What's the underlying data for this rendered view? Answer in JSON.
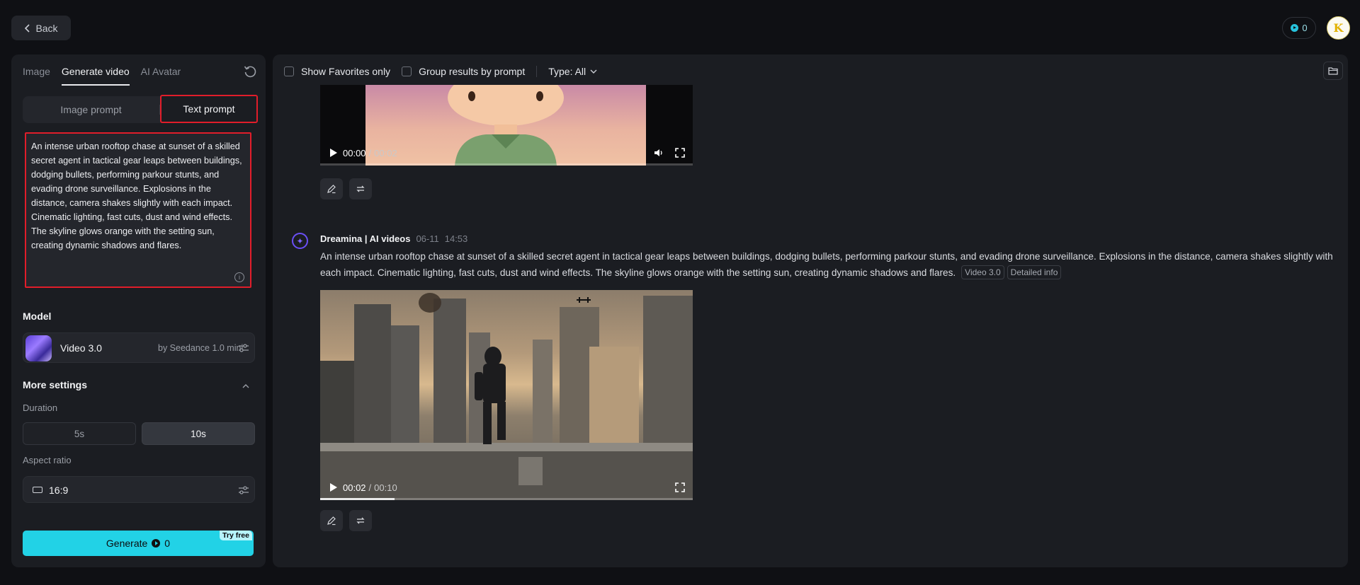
{
  "topbar": {
    "back_label": "Back",
    "credits": "0",
    "avatar_letter": "K"
  },
  "left": {
    "tabs": [
      {
        "label": "Image",
        "active": false
      },
      {
        "label": "Generate video",
        "active": true
      },
      {
        "label": "AI Avatar",
        "active": false
      }
    ],
    "prompt_modes": [
      {
        "label": "Image prompt",
        "active": false
      },
      {
        "label": "Text prompt",
        "active": true
      }
    ],
    "prompt_text": "An intense urban rooftop chase at sunset of a skilled secret agent in tactical gear leaps between buildings, dodging bullets, performing parkour stunts, and evading drone surveillance. Explosions in the distance, camera shakes slightly with each impact. Cinematic lighting, fast cuts, dust and wind effects. The skyline glows orange with the setting sun, creating dynamic shadows and flares.",
    "model_title": "Model",
    "model_name": "Video 3.0",
    "model_by": "by Seedance 1.0 mini",
    "more_settings": "More settings",
    "duration_label": "Duration",
    "durations": [
      {
        "label": "5s",
        "active": false
      },
      {
        "label": "10s",
        "active": true
      }
    ],
    "aspect_label": "Aspect ratio",
    "aspect_value": "16:9",
    "generate_label": "Generate",
    "generate_cost": "0",
    "try_free": "Try free"
  },
  "right": {
    "filters": {
      "favorites_label": "Show Favorites only",
      "group_label": "Group results by prompt",
      "type_label": "Type: All"
    },
    "video1": {
      "current": "00:00",
      "total": "00:02",
      "progress": 0.0
    },
    "entry": {
      "author": "Dreamina | AI videos",
      "date": "06-11",
      "time": "14:53",
      "prompt": "An intense urban rooftop chase at sunset of a skilled secret agent in tactical gear leaps between buildings, dodging bullets, performing parkour stunts, and evading drone surveillance. Explosions in the distance, camera shakes slightly with each impact. Cinematic lighting, fast cuts, dust and wind effects. The skyline glows orange with the setting sun, creating dynamic shadows and flares.",
      "tags": [
        "Video 3.0",
        "Detailed info"
      ]
    },
    "video2": {
      "current": "00:02",
      "total": "00:10",
      "progress": 0.2
    }
  },
  "colors": {
    "accent": "#22d2e6",
    "highlight": "#e11d2a",
    "brand_purple": "#6a4ff5"
  }
}
